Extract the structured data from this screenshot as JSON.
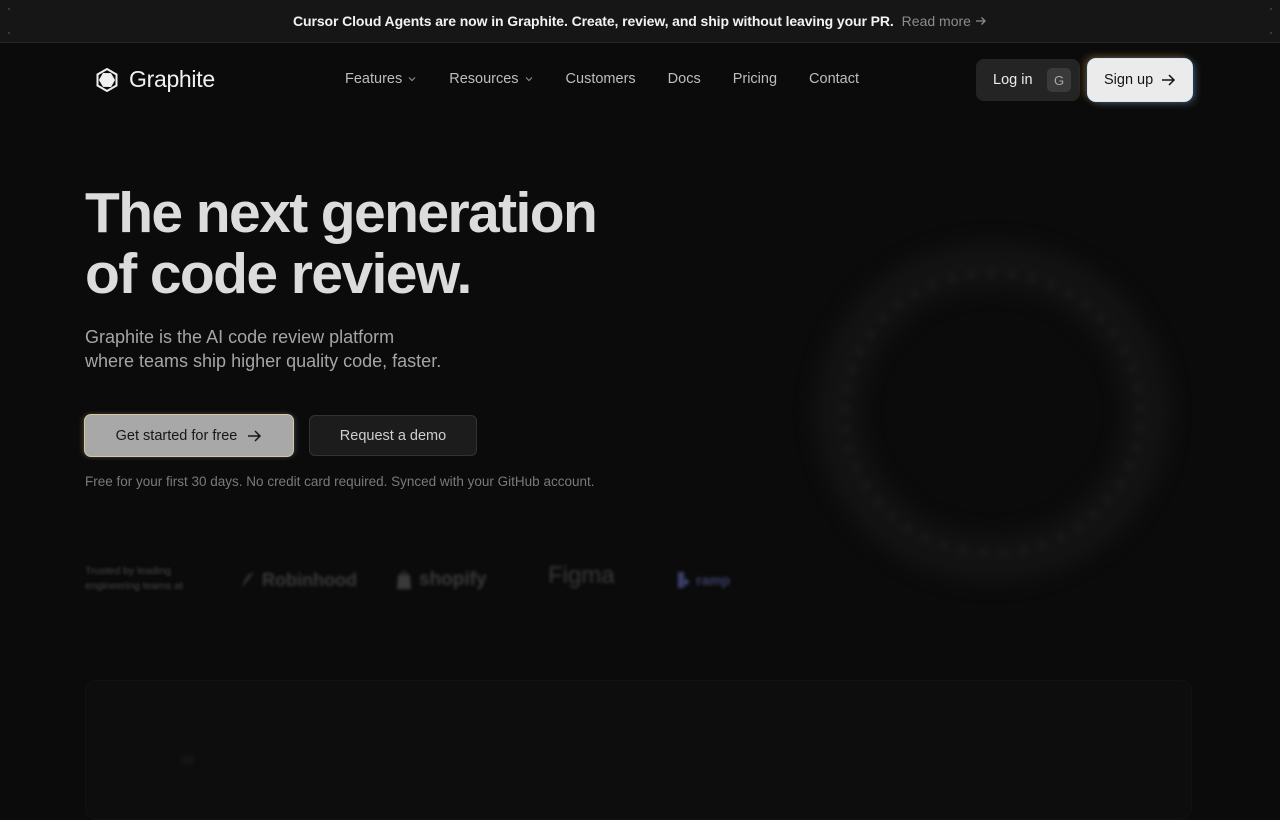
{
  "announcement": {
    "message": "Cursor Cloud Agents are now in Graphite. Create, review, and ship without leaving your PR.",
    "link": "Read more"
  },
  "nav": {
    "brand": "Graphite",
    "links": [
      "Features",
      "Resources",
      "Customers",
      "Docs",
      "Pricing",
      "Contact"
    ],
    "login": "Log in",
    "login_key": "G",
    "signup": "Sign up"
  },
  "hero": {
    "title_line1": "The next generation",
    "title_line2": "of code review.",
    "subtitle_line1": "Graphite is the AI code review platform",
    "subtitle_line2": "where teams ship higher quality code, faster.",
    "cta_primary": "Get started for free",
    "cta_secondary": "Request a demo",
    "fine_print": "Free for your first 30 days. No credit card required. Synced with your GitHub account."
  },
  "logos": {
    "trusted_label_line1": "Trusted by leading",
    "trusted_label_line2": "engineering teams at",
    "brands": [
      "Robinhood",
      "shopify",
      "Figma",
      "ramp"
    ]
  },
  "colors": {
    "background": "#0b0b0b",
    "banner": "#161616",
    "signup_bg": "#ebebeb",
    "cta_primary_bg": "#a8a8a8"
  }
}
